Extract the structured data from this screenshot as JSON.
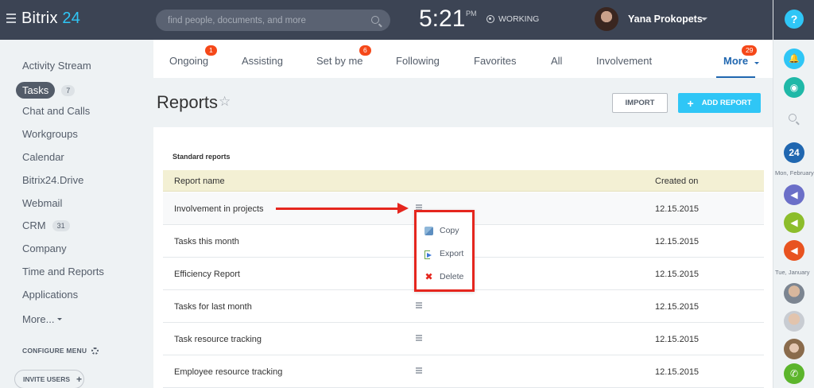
{
  "app": {
    "logo_name": "Bitrix",
    "logo_num": "24"
  },
  "search": {
    "placeholder": "find people, documents, and more"
  },
  "clock": {
    "time": "5:21",
    "ampm": "PM",
    "status": "WORKING"
  },
  "user": {
    "name": "Yana Prokopets"
  },
  "sidebar": {
    "items": [
      {
        "label": "Activity Stream"
      },
      {
        "label": "Tasks",
        "counter": "7"
      },
      {
        "label": "Chat and Calls"
      },
      {
        "label": "Workgroups"
      },
      {
        "label": "Calendar"
      },
      {
        "label": "Bitrix24.Drive"
      },
      {
        "label": "Webmail"
      },
      {
        "label": "CRM",
        "counter": "31"
      },
      {
        "label": "Company"
      },
      {
        "label": "Time and Reports"
      },
      {
        "label": "Applications"
      },
      {
        "label": "More..."
      }
    ],
    "configure": "CONFIGURE MENU",
    "invite": "INVITE USERS"
  },
  "tabs": [
    {
      "label": "Ongoing",
      "badge": "1"
    },
    {
      "label": "Assisting"
    },
    {
      "label": "Set by me",
      "badge": "6"
    },
    {
      "label": "Following"
    },
    {
      "label": "Favorites"
    },
    {
      "label": "All"
    },
    {
      "label": "Involvement"
    },
    {
      "label": "More",
      "badge": "29"
    }
  ],
  "page": {
    "title": "Reports",
    "star": "☆",
    "import_label": "IMPORT",
    "add_label": "ADD REPORT"
  },
  "reports": {
    "section": "Standard reports",
    "headers": {
      "name": "Report name",
      "created": "Created on"
    },
    "rows": [
      {
        "name": "Involvement in projects",
        "created": "12.15.2015"
      },
      {
        "name": "Tasks this month",
        "created": "12.15.2015"
      },
      {
        "name": "Efficiency Report",
        "created": "12.15.2015"
      },
      {
        "name": "Tasks for last month",
        "created": "12.15.2015"
      },
      {
        "name": "Task resource tracking",
        "created": "12.15.2015"
      },
      {
        "name": "Employee resource tracking",
        "created": "12.15.2015"
      }
    ]
  },
  "row_menu": {
    "copy": "Copy",
    "export": "Export",
    "delete": "Delete"
  },
  "rightrail": {
    "help": "?",
    "date1": "Mon, February",
    "date2": "Tue, January",
    "calendar_num": "24"
  },
  "colors": {
    "header": "#3c4454",
    "accent": "#2fc6f6",
    "badge": "#f54819",
    "annotation": "#e5261e"
  }
}
